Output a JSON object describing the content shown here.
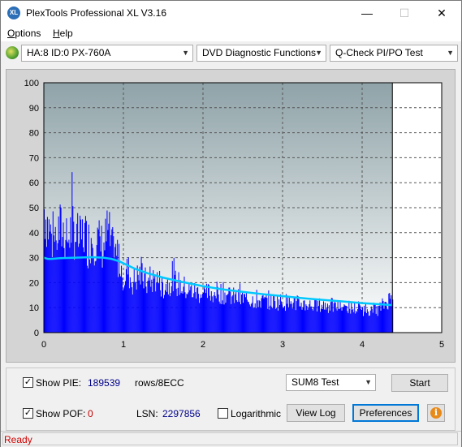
{
  "window": {
    "title": "PlexTools Professional XL V3.16",
    "app_icon_text": "XL",
    "minimize_glyph": "—",
    "maximize_glyph": "☐",
    "close_glyph": "✕"
  },
  "menu": [
    {
      "label": "Options",
      "accel": "O",
      "rest": "ptions"
    },
    {
      "label": "Help",
      "accel": "H",
      "rest": "elp"
    }
  ],
  "toolbar": {
    "drive": "HA:8 ID:0  PX-760A",
    "function": "DVD Diagnostic Functions",
    "test": "Q-Check PI/PO Test",
    "arrow": "▼"
  },
  "chart_data": {
    "type": "bar",
    "x_axis": {
      "min": 0,
      "max": 5,
      "ticks": [
        "0",
        "1",
        "2",
        "3",
        "4",
        "5"
      ]
    },
    "y_axis": {
      "min": 0,
      "max": 100,
      "ticks": [
        "0",
        "10",
        "20",
        "30",
        "40",
        "50",
        "60",
        "70",
        "80",
        "90",
        "100"
      ]
    },
    "grid": true,
    "end_marker_x": 4.38,
    "colors": {
      "pie_bars": "#0000ff",
      "average_line": "#00c8ff",
      "plot_bg_top": "#8fa3a8",
      "plot_bg_bottom": "#ffffff"
    },
    "series": [
      {
        "kind": "pie_envelope",
        "x": [
          0.0,
          0.05,
          0.1,
          0.15,
          0.2,
          0.25,
          0.3,
          0.35,
          0.4,
          0.45,
          0.5,
          0.55,
          0.6,
          0.65,
          0.7,
          0.75,
          0.8,
          0.85,
          0.9,
          0.95,
          1.0,
          1.05,
          1.1,
          1.2,
          1.3,
          1.4,
          1.5,
          1.6,
          1.8,
          2.0,
          2.2,
          2.4,
          2.6,
          2.8,
          3.0,
          3.2,
          3.4,
          3.6,
          3.8,
          4.0,
          4.2,
          4.38
        ],
        "y": [
          64,
          55,
          48,
          50,
          53,
          52,
          48,
          55,
          50,
          47,
          52,
          46,
          50,
          48,
          46,
          44,
          53,
          43,
          40,
          38,
          28,
          33,
          26,
          30,
          25,
          28,
          24,
          27,
          22,
          20,
          21,
          18,
          17,
          16,
          16,
          15,
          14,
          14,
          13,
          12,
          12,
          19
        ]
      },
      {
        "kind": "average",
        "x": [
          0.0,
          0.05,
          0.1,
          0.2,
          0.4,
          0.6,
          0.75,
          0.85,
          0.95,
          1.05,
          1.15,
          1.3,
          1.5,
          1.75,
          2.0,
          2.25,
          2.5,
          2.75,
          3.0,
          3.25,
          3.5,
          3.75,
          4.0,
          4.2,
          4.38
        ],
        "y": [
          30,
          29.5,
          29.5,
          29.8,
          30,
          30.2,
          30,
          29.5,
          28.5,
          27,
          25.5,
          23.8,
          22,
          20.2,
          18.6,
          17.3,
          16.3,
          15.4,
          14.6,
          13.8,
          13.1,
          12.5,
          11.8,
          11.4,
          11
        ]
      }
    ]
  },
  "bottom": {
    "show_pie_label": "Show PIE:",
    "pie_value": "189539",
    "pie_unit": "rows/8ECC",
    "show_pof_label": "Show POF:",
    "pof_value": "0",
    "lsn_label": "LSN:",
    "lsn_value": "2297856",
    "logarithmic_label": "Logarithmic",
    "test_select": "SUM8 Test",
    "start_label": "Start",
    "view_log_label": "View Log",
    "preferences_label": "Preferences",
    "check_glyph": "✓",
    "info_glyph": "i"
  },
  "status": {
    "text": "Ready"
  }
}
